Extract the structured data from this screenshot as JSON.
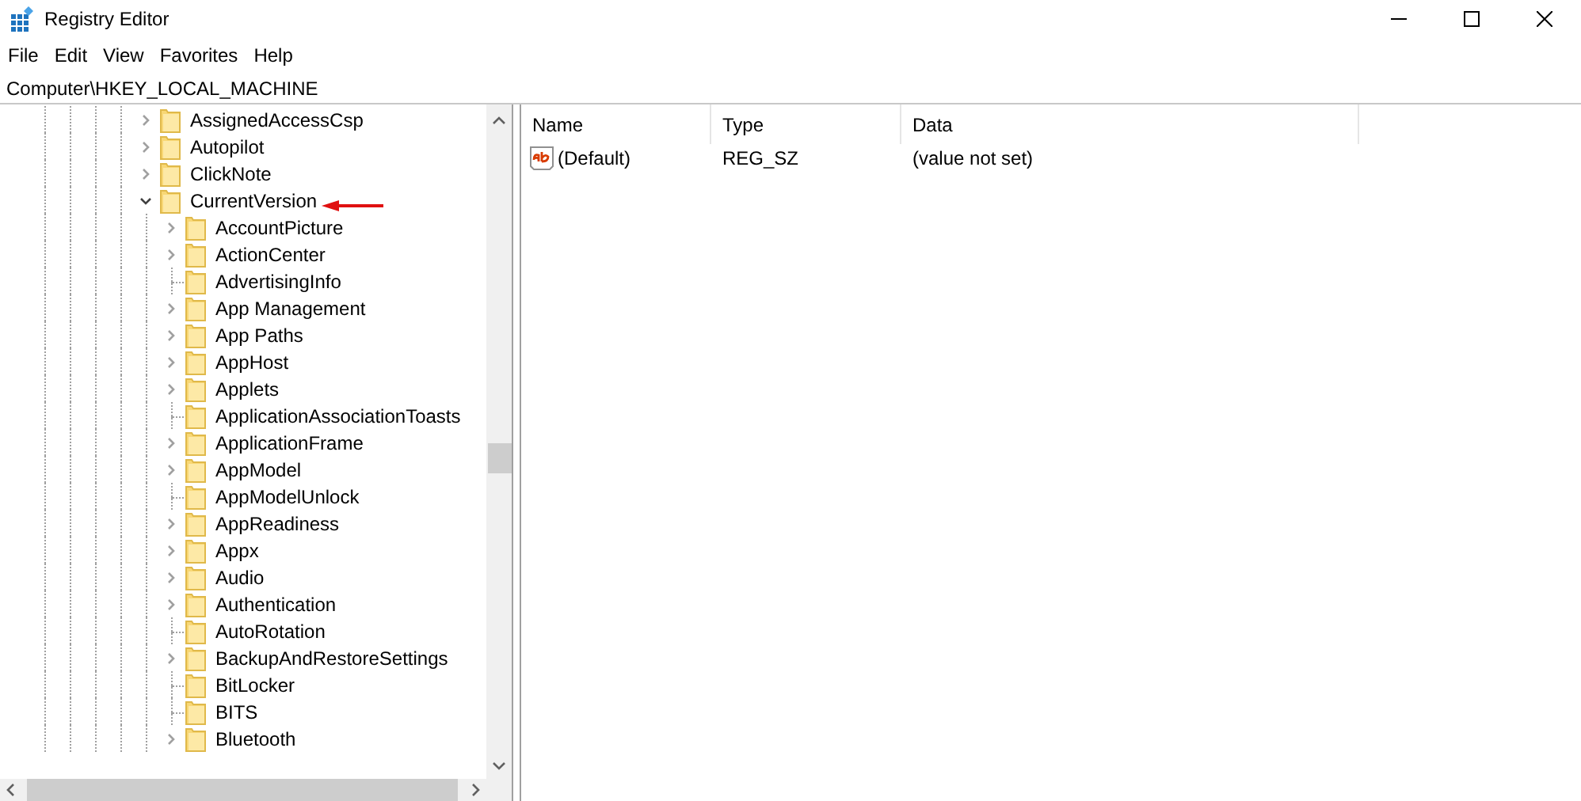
{
  "window": {
    "title": "Registry Editor"
  },
  "menu": [
    "File",
    "Edit",
    "View",
    "Favorites",
    "Help"
  ],
  "address": "Computer\\HKEY_LOCAL_MACHINE",
  "tree": [
    {
      "label": "AssignedAccessCsp",
      "kind": "branch",
      "expanded": false
    },
    {
      "label": "Autopilot",
      "kind": "branch",
      "expanded": false
    },
    {
      "label": "ClickNote",
      "kind": "branch",
      "expanded": false
    },
    {
      "label": "CurrentVersion",
      "kind": "branch",
      "expanded": true,
      "children": [
        {
          "label": "AccountPicture",
          "kind": "branch",
          "expanded": false
        },
        {
          "label": "ActionCenter",
          "kind": "branch",
          "expanded": false
        },
        {
          "label": "AdvertisingInfo",
          "kind": "leaf"
        },
        {
          "label": "App Management",
          "kind": "branch",
          "expanded": false
        },
        {
          "label": "App Paths",
          "kind": "branch",
          "expanded": false
        },
        {
          "label": "AppHost",
          "kind": "branch",
          "expanded": false
        },
        {
          "label": "Applets",
          "kind": "branch",
          "expanded": false
        },
        {
          "label": "ApplicationAssociationToasts",
          "kind": "leaf"
        },
        {
          "label": "ApplicationFrame",
          "kind": "branch",
          "expanded": false
        },
        {
          "label": "AppModel",
          "kind": "branch",
          "expanded": false
        },
        {
          "label": "AppModelUnlock",
          "kind": "leaf"
        },
        {
          "label": "AppReadiness",
          "kind": "branch",
          "expanded": false
        },
        {
          "label": "Appx",
          "kind": "branch",
          "expanded": false
        },
        {
          "label": "Audio",
          "kind": "branch",
          "expanded": false
        },
        {
          "label": "Authentication",
          "kind": "branch",
          "expanded": false
        },
        {
          "label": "AutoRotation",
          "kind": "leaf"
        },
        {
          "label": "BackupAndRestoreSettings",
          "kind": "branch",
          "expanded": false
        },
        {
          "label": "BitLocker",
          "kind": "leaf"
        },
        {
          "label": "BITS",
          "kind": "leaf"
        },
        {
          "label": "Bluetooth",
          "kind": "branch",
          "expanded": false
        }
      ]
    }
  ],
  "values": {
    "columns": [
      "Name",
      "Type",
      "Data"
    ],
    "rows": [
      {
        "name": "(Default)",
        "type": "REG_SZ",
        "data": "(value not set)"
      }
    ]
  }
}
